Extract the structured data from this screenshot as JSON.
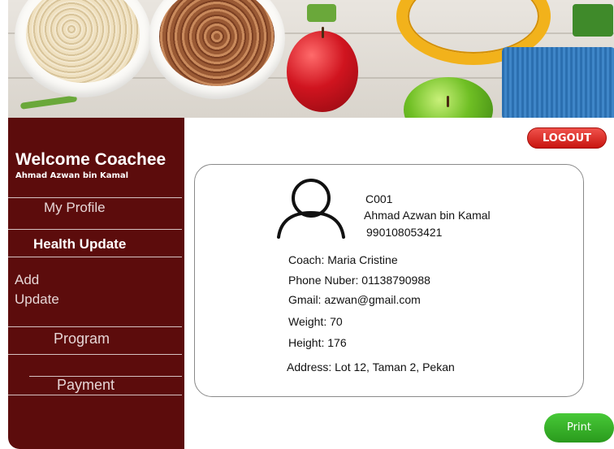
{
  "sidebar": {
    "welcome": "Welcome Coachee",
    "user_name": "Ahmad Azwan bin Kamal",
    "items": {
      "my_profile": "My Profile",
      "health_update": "Health Update",
      "add_update_line1": "Add",
      "add_update_line2": "Update",
      "program": "Program",
      "payment": "Payment"
    }
  },
  "header": {
    "logout_label": "LOGOUT"
  },
  "profile": {
    "id": "C001",
    "name": "Ahmad Azwan  bin Kamal",
    "ic": "990108053421",
    "coach": "Coach: Maria Cristine",
    "phone": "Phone Nuber: 01138790988",
    "gmail": "Gmail: azwan@gmail.com",
    "weight": "Weight: 70",
    "height": "Height: 176",
    "address": "Address: Lot 12, Taman 2, Pekan"
  },
  "actions": {
    "print_label": "Print"
  },
  "colors": {
    "sidebar": "#5c0c0c",
    "logout": "#d61b14",
    "print": "#36b227"
  },
  "icons": {
    "avatar": "user-avatar-icon"
  }
}
